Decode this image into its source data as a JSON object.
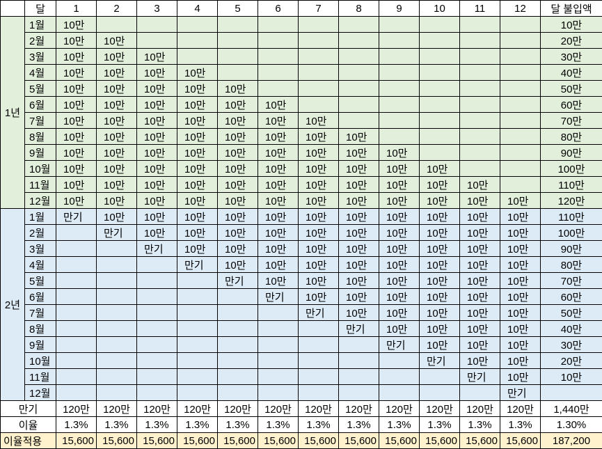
{
  "header": {
    "corner": "",
    "month_label": "달",
    "cols": [
      "1",
      "2",
      "3",
      "4",
      "5",
      "6",
      "7",
      "8",
      "9",
      "10",
      "11",
      "12"
    ],
    "total_label": "달 불입액"
  },
  "years": [
    {
      "label": "1년",
      "rows": [
        {
          "m": "1월",
          "cells": [
            "10만",
            "",
            "",
            "",
            "",
            "",
            "",
            "",
            "",
            "",
            "",
            ""
          ],
          "total": "10만"
        },
        {
          "m": "2월",
          "cells": [
            "10만",
            "10만",
            "",
            "",
            "",
            "",
            "",
            "",
            "",
            "",
            "",
            ""
          ],
          "total": "20만"
        },
        {
          "m": "3월",
          "cells": [
            "10만",
            "10만",
            "10만",
            "",
            "",
            "",
            "",
            "",
            "",
            "",
            "",
            ""
          ],
          "total": "30만"
        },
        {
          "m": "4월",
          "cells": [
            "10만",
            "10만",
            "10만",
            "10만",
            "",
            "",
            "",
            "",
            "",
            "",
            "",
            ""
          ],
          "total": "40만"
        },
        {
          "m": "5월",
          "cells": [
            "10만",
            "10만",
            "10만",
            "10만",
            "10만",
            "",
            "",
            "",
            "",
            "",
            "",
            ""
          ],
          "total": "50만"
        },
        {
          "m": "6월",
          "cells": [
            "10만",
            "10만",
            "10만",
            "10만",
            "10만",
            "10만",
            "",
            "",
            "",
            "",
            "",
            ""
          ],
          "total": "60만"
        },
        {
          "m": "7월",
          "cells": [
            "10만",
            "10만",
            "10만",
            "10만",
            "10만",
            "10만",
            "10만",
            "",
            "",
            "",
            "",
            ""
          ],
          "total": "70만"
        },
        {
          "m": "8월",
          "cells": [
            "10만",
            "10만",
            "10만",
            "10만",
            "10만",
            "10만",
            "10만",
            "10만",
            "",
            "",
            "",
            ""
          ],
          "total": "80만"
        },
        {
          "m": "9월",
          "cells": [
            "10만",
            "10만",
            "10만",
            "10만",
            "10만",
            "10만",
            "10만",
            "10만",
            "10만",
            "",
            "",
            ""
          ],
          "total": "90만"
        },
        {
          "m": "10월",
          "cells": [
            "10만",
            "10만",
            "10만",
            "10만",
            "10만",
            "10만",
            "10만",
            "10만",
            "10만",
            "10만",
            "",
            ""
          ],
          "total": "100만"
        },
        {
          "m": "11월",
          "cells": [
            "10만",
            "10만",
            "10만",
            "10만",
            "10만",
            "10만",
            "10만",
            "10만",
            "10만",
            "10만",
            "10만",
            ""
          ],
          "total": "110만"
        },
        {
          "m": "12월",
          "cells": [
            "10만",
            "10만",
            "10만",
            "10만",
            "10만",
            "10만",
            "10만",
            "10만",
            "10만",
            "10만",
            "10만",
            "10만"
          ],
          "total": "120만"
        }
      ]
    },
    {
      "label": "2년",
      "rows": [
        {
          "m": "1월",
          "cells": [
            "만기",
            "10만",
            "10만",
            "10만",
            "10만",
            "10만",
            "10만",
            "10만",
            "10만",
            "10만",
            "10만",
            "10만"
          ],
          "total": "110만"
        },
        {
          "m": "2월",
          "cells": [
            "",
            "만기",
            "10만",
            "10만",
            "10만",
            "10만",
            "10만",
            "10만",
            "10만",
            "10만",
            "10만",
            "10만"
          ],
          "total": "100만"
        },
        {
          "m": "3월",
          "cells": [
            "",
            "",
            "만기",
            "10만",
            "10만",
            "10만",
            "10만",
            "10만",
            "10만",
            "10만",
            "10만",
            "10만"
          ],
          "total": "90만"
        },
        {
          "m": "4월",
          "cells": [
            "",
            "",
            "",
            "만기",
            "10만",
            "10만",
            "10만",
            "10만",
            "10만",
            "10만",
            "10만",
            "10만"
          ],
          "total": "80만"
        },
        {
          "m": "5월",
          "cells": [
            "",
            "",
            "",
            "",
            "만기",
            "10만",
            "10만",
            "10만",
            "10만",
            "10만",
            "10만",
            "10만"
          ],
          "total": "70만"
        },
        {
          "m": "6월",
          "cells": [
            "",
            "",
            "",
            "",
            "",
            "만기",
            "10만",
            "10만",
            "10만",
            "10만",
            "10만",
            "10만"
          ],
          "total": "60만"
        },
        {
          "m": "7월",
          "cells": [
            "",
            "",
            "",
            "",
            "",
            "",
            "만기",
            "10만",
            "10만",
            "10만",
            "10만",
            "10만"
          ],
          "total": "50만"
        },
        {
          "m": "8월",
          "cells": [
            "",
            "",
            "",
            "",
            "",
            "",
            "",
            "만기",
            "10만",
            "10만",
            "10만",
            "10만"
          ],
          "total": "40만"
        },
        {
          "m": "9월",
          "cells": [
            "",
            "",
            "",
            "",
            "",
            "",
            "",
            "",
            "만기",
            "10만",
            "10만",
            "10만"
          ],
          "total": "30만"
        },
        {
          "m": "10월",
          "cells": [
            "",
            "",
            "",
            "",
            "",
            "",
            "",
            "",
            "",
            "만기",
            "10만",
            "10만"
          ],
          "total": "20만"
        },
        {
          "m": "11월",
          "cells": [
            "",
            "",
            "",
            "",
            "",
            "",
            "",
            "",
            "",
            "",
            "만기",
            "10만"
          ],
          "total": "10만"
        },
        {
          "m": "12월",
          "cells": [
            "",
            "",
            "",
            "",
            "",
            "",
            "",
            "",
            "",
            "",
            "",
            "만기"
          ],
          "total": ""
        }
      ]
    }
  ],
  "footer": {
    "maturity": {
      "label": "만기",
      "cells": [
        "120만",
        "120만",
        "120만",
        "120만",
        "120만",
        "120만",
        "120만",
        "120만",
        "120만",
        "120만",
        "120만",
        "120만"
      ],
      "total": "1,440만"
    },
    "rate": {
      "label": "이율",
      "cells": [
        "1.3%",
        "1.3%",
        "1.3%",
        "1.3%",
        "1.3%",
        "1.3%",
        "1.3%",
        "1.3%",
        "1.3%",
        "1.3%",
        "1.3%",
        "1.3%"
      ],
      "total": "1.30%"
    },
    "applied": {
      "label": "이율적용",
      "cells": [
        "15,600",
        "15,600",
        "15,600",
        "15,600",
        "15,600",
        "15,600",
        "15,600",
        "15,600",
        "15,600",
        "15,600",
        "15,600",
        "15,600"
      ],
      "total": "187,200"
    }
  },
  "colors": {
    "year1_bg": "#e2efda",
    "year2_bg": "#ddebf7",
    "applied_bg": "#fff2cc",
    "border": "#000000"
  }
}
